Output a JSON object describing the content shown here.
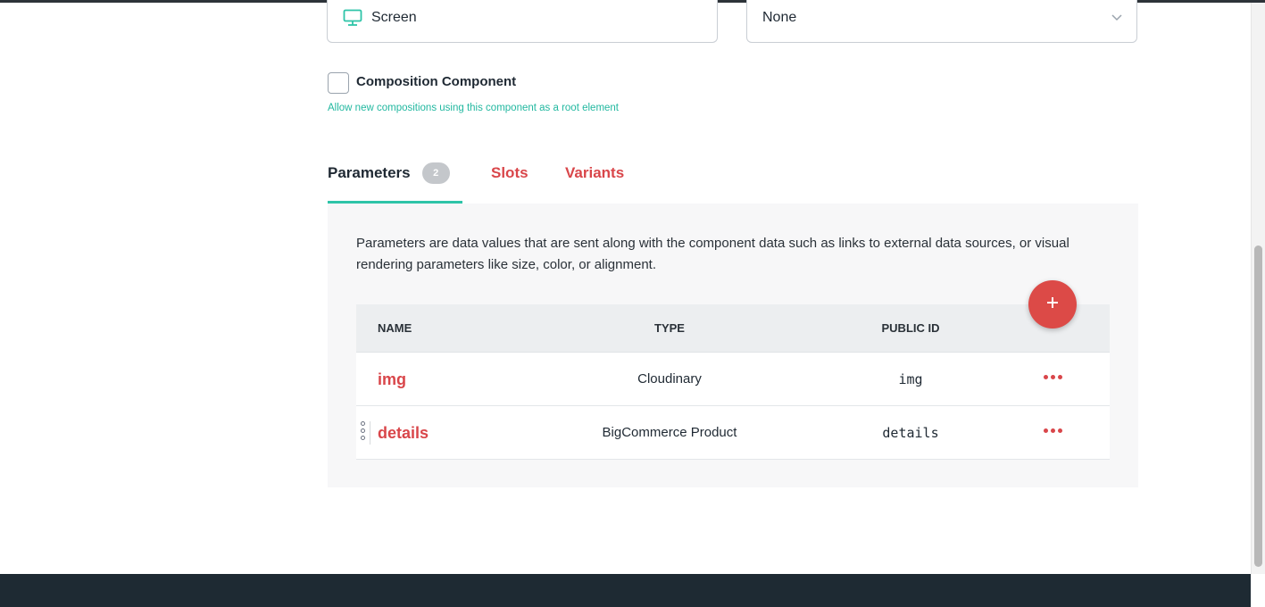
{
  "fields": {
    "icon_field": {
      "icon": "monitor-icon",
      "value": "Screen"
    },
    "select_field": {
      "value": "None",
      "icon": "chevron-down-icon"
    }
  },
  "composition": {
    "label": "Composition Component",
    "help": "Allow new compositions using this component as a root element",
    "checked": false
  },
  "tabs": [
    {
      "label": "Parameters",
      "count": "2",
      "active": true
    },
    {
      "label": "Slots",
      "active": false
    },
    {
      "label": "Variants",
      "active": false
    }
  ],
  "parameters": {
    "description": "Parameters are data values that are sent along with the component data such as links to external data sources, or visual rendering parameters like size, color, or alignment.",
    "add_icon": "plus-icon",
    "columns": {
      "name": "NAME",
      "type": "TYPE",
      "public_id": "PUBLIC ID"
    },
    "rows": [
      {
        "name": "img",
        "type": "Cloudinary",
        "public_id": "img"
      },
      {
        "name": "details",
        "type": "BigCommerce Product",
        "public_id": "details"
      }
    ]
  },
  "colors": {
    "accent_teal": "#2ec4a8",
    "accent_red": "#d9464a",
    "footer": "#1e2a33"
  }
}
